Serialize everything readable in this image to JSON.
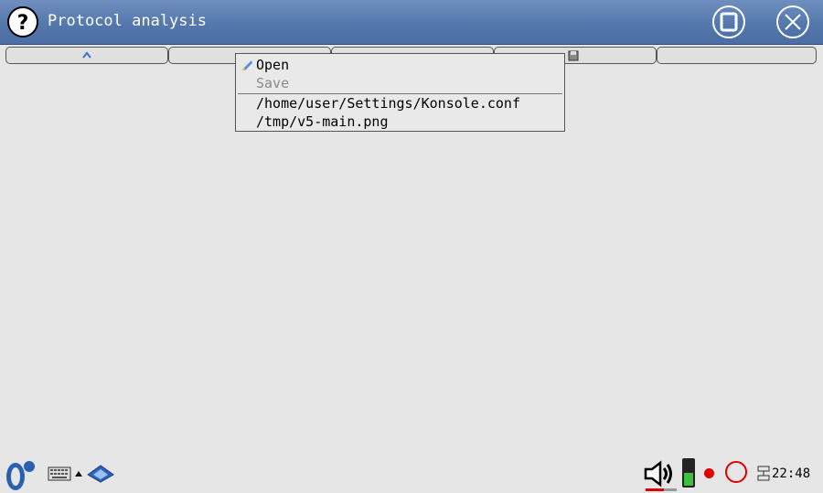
{
  "window": {
    "title": "Protocol analysis",
    "help_icon": "help-icon",
    "maximize_icon": "maximize-icon",
    "close_icon": "close-icon"
  },
  "toolbar": {
    "buttons": [
      {
        "icon": "chevron-up-icon"
      },
      {
        "icon": ""
      },
      {
        "icon": ""
      },
      {
        "icon": "save-disk-icon"
      },
      {
        "icon": ""
      }
    ]
  },
  "menu": {
    "open_label": "Open",
    "save_label": "Save",
    "recent": [
      "/home/user/Settings/Konsole.conf",
      "/tmp/v5-main.png"
    ]
  },
  "taskbar": {
    "clock": "22:48",
    "icons": [
      "start-menu-icon",
      "keyboard-icon",
      "arrow-up-small-icon",
      "diamond-app-icon",
      "speaker-icon",
      "battery-icon",
      "record-dot-icon",
      "circle-icon",
      "network-icon"
    ]
  },
  "colors": {
    "titlebar": "#5478ad",
    "background": "#e6e6e6",
    "record": "#e00000"
  }
}
